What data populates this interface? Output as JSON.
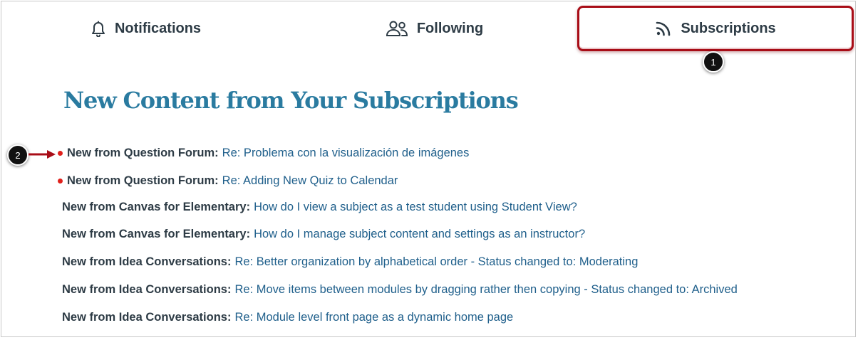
{
  "tabs": {
    "notifications": {
      "label": "Notifications",
      "icon": "bell-icon"
    },
    "following": {
      "label": "Following",
      "icon": "users-icon"
    },
    "subscriptions": {
      "label": "Subscriptions",
      "icon": "rss-icon",
      "selected": true
    }
  },
  "callouts": {
    "one": "1",
    "two": "2"
  },
  "heading": "New Content from Your Subscriptions",
  "colors": {
    "heading": "#2a7ba0",
    "link": "#1f5f8b",
    "unread_dot": "#e0201b",
    "highlight_border": "#a80d17"
  },
  "feed": [
    {
      "source": "New from Question Forum:",
      "title": "Re: Problema con la visualización de imágenes",
      "unread": true
    },
    {
      "source": "New from Question Forum:",
      "title": "Re: Adding New Quiz to Calendar",
      "unread": true
    },
    {
      "source": "New from Canvas for Elementary:",
      "title": "How do I view a subject as a test student using Student View?",
      "unread": false
    },
    {
      "source": "New from Canvas for Elementary:",
      "title": "How do I manage subject content and settings as an instructor?",
      "unread": false
    },
    {
      "source": "New from Idea Conversations:",
      "title": "Re: Better organization by alphabetical order - Status changed to: Moderating",
      "unread": false
    },
    {
      "source": "New from Idea Conversations:",
      "title": "Re: Move items between modules by dragging rather then copying - Status changed to: Archived",
      "unread": false
    },
    {
      "source": "New from Idea Conversations:",
      "title": "Re: Module level front page as a dynamic home page",
      "unread": false
    }
  ]
}
